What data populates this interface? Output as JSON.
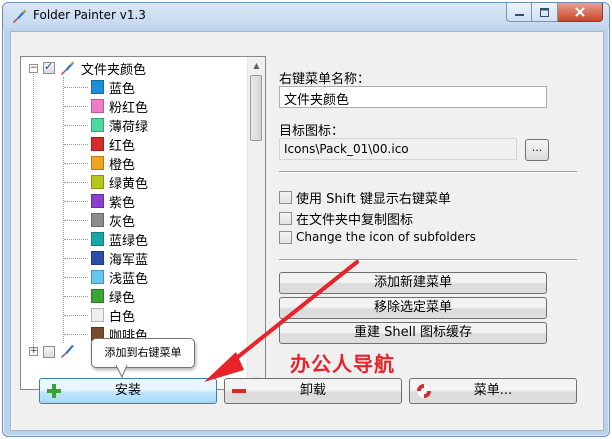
{
  "window": {
    "title": "Folder Painter v1.3"
  },
  "tree": {
    "root_label": "文件夹颜色",
    "items": [
      {
        "label": "蓝色",
        "color": "#1c8fd8"
      },
      {
        "label": "粉红色",
        "color": "#f07cc8"
      },
      {
        "label": "薄荷绿",
        "color": "#4fd7a0"
      },
      {
        "label": "红色",
        "color": "#d62b2b"
      },
      {
        "label": "橙色",
        "color": "#f3a324"
      },
      {
        "label": "绿黄色",
        "color": "#b4c71c"
      },
      {
        "label": "紫色",
        "color": "#8a3fd1"
      },
      {
        "label": "灰色",
        "color": "#8c8c8c"
      },
      {
        "label": "蓝绿色",
        "color": "#1aa6a6"
      },
      {
        "label": "海军蓝",
        "color": "#2b4fa8"
      },
      {
        "label": "浅蓝色",
        "color": "#63c6ee"
      },
      {
        "label": "绿色",
        "color": "#3aa336"
      },
      {
        "label": "白色",
        "color": "#efefef"
      },
      {
        "label": "咖啡色",
        "color": "#7a4a2e"
      }
    ]
  },
  "form": {
    "menu_name_label": "右键菜单名称：",
    "menu_name_value": "文件夹颜色",
    "icon_label": "目标图标：",
    "icon_value": "Icons\\Pack_01\\00.ico",
    "browse_label": "...",
    "options": [
      "使用 Shift 键显示右键菜单",
      "在文件夹中复制图标",
      "Change the icon of subfolders"
    ],
    "buttons": {
      "add_menu": "添加新建菜单",
      "remove_menu": "移除选定菜单",
      "rebuild_cache": "重建 Shell 图标缓存"
    }
  },
  "bottom": {
    "install": "安装",
    "uninstall": "卸载",
    "menu": "菜单..."
  },
  "tooltip": "添加到右键菜单",
  "watermark": "办公人导航"
}
